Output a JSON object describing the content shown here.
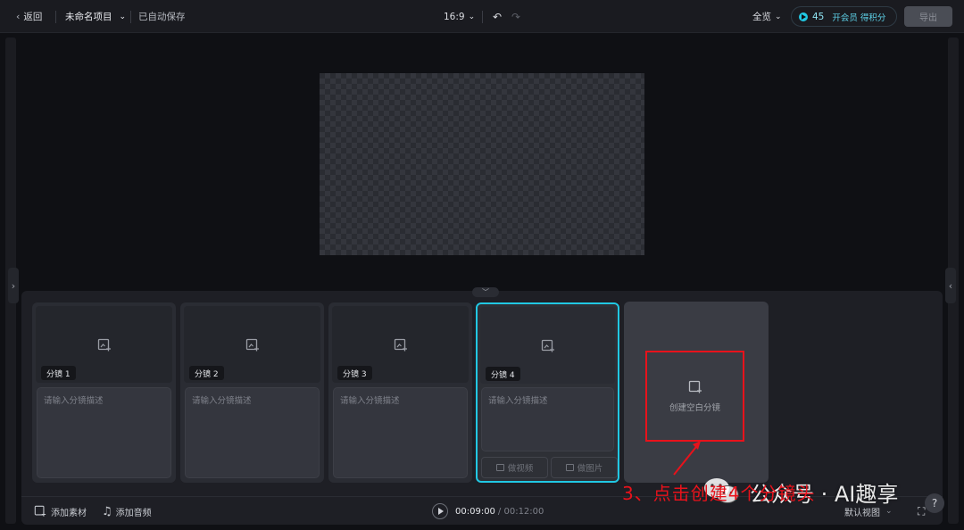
{
  "topbar": {
    "back_label": "返回",
    "project_name": "未命名项目",
    "autosave": "已自动保存",
    "ratio": "16:9",
    "zoom": "全览",
    "credits": "45",
    "vip_label": "开会员 得积分",
    "export_label": "导出"
  },
  "shots": [
    {
      "label": "分镜 1",
      "placeholder": "请输入分镜描述"
    },
    {
      "label": "分镜 2",
      "placeholder": "请输入分镜描述"
    },
    {
      "label": "分镜 3",
      "placeholder": "请输入分镜描述"
    },
    {
      "label": "分镜 4",
      "placeholder": "请输入分镜描述",
      "actions": [
        "做视频",
        "做图片"
      ]
    }
  ],
  "new_shot_label": "创建空白分镜",
  "bottom": {
    "add_material": "添加素材",
    "add_audio": "添加音频",
    "time_current": "00:09:00",
    "time_total": "/ 00:12:00",
    "view_mode": "默认视图"
  },
  "annotation": "3、点击创建4个分镜头",
  "watermark": "公众号 · AI趣享",
  "colors": {
    "accent": "#21c8e3",
    "annotation": "#e8121b"
  }
}
